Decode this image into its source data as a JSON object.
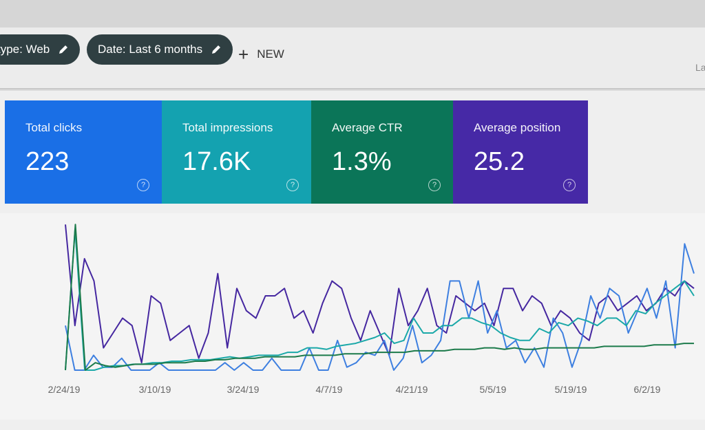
{
  "filters": {
    "chips": [
      {
        "label": "type: Web",
        "icon": "pencil-icon"
      },
      {
        "label": "Date: Last 6 months",
        "icon": "pencil-icon"
      }
    ],
    "new_label": "NEW",
    "right_text": "La"
  },
  "cards": [
    {
      "label": "Total clicks",
      "value": "223",
      "color": "#1a6fe6"
    },
    {
      "label": "Total impressions",
      "value": "17.6K",
      "color": "#14a2b0"
    },
    {
      "label": "Average CTR",
      "value": "1.3%",
      "color": "#0b7558"
    },
    {
      "label": "Average position",
      "value": "25.2",
      "color": "#4629a6"
    }
  ],
  "help_glyph": "?",
  "chart_data": {
    "type": "line",
    "grid": false,
    "x_tick_labels": [
      "2/24/19",
      "3/10/19",
      "3/24/19",
      "4/7/19",
      "4/21/19",
      "5/5/19",
      "5/19/19",
      "6/2/19"
    ],
    "ylim": [
      0,
      100
    ],
    "series": [
      {
        "color": "#4527a0",
        "values": [
          98,
          30,
          75,
          60,
          15,
          25,
          35,
          30,
          5,
          50,
          45,
          20,
          25,
          30,
          8,
          25,
          65,
          15,
          55,
          40,
          35,
          50,
          50,
          55,
          35,
          40,
          25,
          45,
          60,
          55,
          35,
          20,
          40,
          25,
          10,
          55,
          30,
          40,
          55,
          30,
          25,
          50,
          45,
          40,
          45,
          30,
          55,
          55,
          40,
          50,
          45,
          30,
          40,
          35,
          25,
          20,
          45,
          50,
          40,
          45,
          50,
          40,
          45,
          55,
          50,
          60,
          55
        ]
      },
      {
        "color": "#3d7fe0",
        "values": [
          30,
          0,
          0,
          10,
          2,
          2,
          8,
          0,
          0,
          0,
          5,
          0,
          0,
          0,
          0,
          0,
          0,
          5,
          0,
          5,
          0,
          0,
          8,
          0,
          0,
          0,
          15,
          0,
          0,
          20,
          2,
          5,
          12,
          10,
          20,
          0,
          8,
          30,
          5,
          10,
          20,
          60,
          60,
          35,
          60,
          25,
          40,
          15,
          20,
          5,
          15,
          2,
          35,
          25,
          2,
          20,
          50,
          35,
          55,
          50,
          25,
          40,
          55,
          35,
          60,
          15,
          85,
          65
        ]
      },
      {
        "color": "#1aa8a8",
        "values": [
          0,
          95,
          0,
          0,
          2,
          3,
          3,
          4,
          4,
          5,
          5,
          6,
          6,
          7,
          7,
          7,
          8,
          9,
          8,
          9,
          10,
          10,
          10,
          12,
          12,
          15,
          15,
          14,
          16,
          17,
          18,
          20,
          22,
          25,
          18,
          20,
          35,
          25,
          25,
          30,
          30,
          35,
          35,
          32,
          30,
          25,
          22,
          20,
          20,
          28,
          25,
          32,
          30,
          35,
          33,
          30,
          35,
          35,
          30,
          40,
          38,
          45,
          50,
          55,
          60,
          50
        ]
      },
      {
        "color": "#1b7a4a",
        "values": [
          0,
          98,
          0,
          5,
          3,
          2,
          3,
          4,
          4,
          4,
          5,
          5,
          5,
          6,
          6,
          7,
          7,
          8,
          8,
          8,
          9,
          9,
          9,
          9,
          10,
          10,
          10,
          10,
          11,
          11,
          11,
          12,
          12,
          12,
          12,
          13,
          13,
          13,
          13,
          14,
          14,
          14,
          15,
          15,
          14,
          15,
          14,
          14,
          15,
          15,
          15,
          15,
          15,
          15,
          16,
          16,
          16,
          16,
          16,
          17,
          17,
          17,
          18,
          18
        ]
      }
    ]
  }
}
